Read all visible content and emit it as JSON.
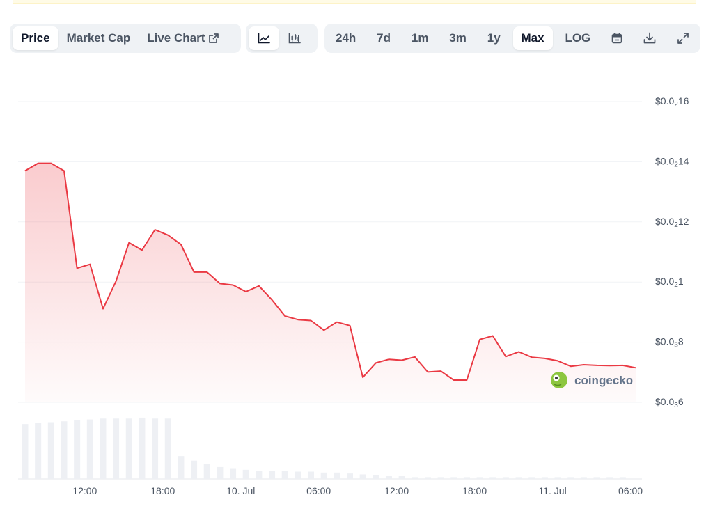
{
  "tabs": [
    {
      "label": "Price",
      "active": true
    },
    {
      "label": "Market Cap",
      "active": false
    },
    {
      "label": "Live Chart",
      "active": false,
      "external": true
    }
  ],
  "chart_types": [
    {
      "icon": "line-chart-icon",
      "active": true
    },
    {
      "icon": "candlestick-chart-icon",
      "active": false
    }
  ],
  "ranges": [
    {
      "label": "24h",
      "active": false
    },
    {
      "label": "7d",
      "active": false
    },
    {
      "label": "1m",
      "active": false
    },
    {
      "label": "3m",
      "active": false
    },
    {
      "label": "1y",
      "active": false
    },
    {
      "label": "Max",
      "active": true
    },
    {
      "label": "LOG",
      "active": false
    }
  ],
  "tool_icons": [
    "calendar-icon",
    "download-icon",
    "expand-icon"
  ],
  "watermark": "coingecko",
  "colors": {
    "line": "#ea3943",
    "volume": "#eef0f4",
    "grid": "#f1f3f6",
    "accent_green": "#8dc63f"
  },
  "chart_data": {
    "type": "area",
    "y_ticks": [
      {
        "prefix": "$0.0",
        "sub": "2",
        "rest": "16",
        "value": 0.0016
      },
      {
        "prefix": "$0.0",
        "sub": "2",
        "rest": "14",
        "value": 0.0014
      },
      {
        "prefix": "$0.0",
        "sub": "2",
        "rest": "12",
        "value": 0.0012
      },
      {
        "prefix": "$0.0",
        "sub": "2",
        "rest": "1",
        "value": 0.001
      },
      {
        "prefix": "$0.0",
        "sub": "3",
        "rest": "8",
        "value": 0.0008
      },
      {
        "prefix": "$0.0",
        "sub": "3",
        "rest": "6",
        "value": 0.0006
      }
    ],
    "ylim": [
      0.0006,
      0.0016
    ],
    "x_ticks": [
      {
        "label": "12:00",
        "hour": 12
      },
      {
        "label": "18:00",
        "hour": 18
      },
      {
        "label": "10. Jul",
        "hour": 24
      },
      {
        "label": "06:00",
        "hour": 30
      },
      {
        "label": "12:00",
        "hour": 36
      },
      {
        "label": "18:00",
        "hour": 42
      },
      {
        "label": "11. Jul",
        "hour": 48
      },
      {
        "label": "06:00",
        "hour": 54
      }
    ],
    "xlim": [
      7.4,
      54.4
    ],
    "price": {
      "hours": [
        7.4,
        8.4,
        9.4,
        10.4,
        11.4,
        12.4,
        13.4,
        14.4,
        15.4,
        16.4,
        17.4,
        18.4,
        19.4,
        20.4,
        21.4,
        22.4,
        23.4,
        24.4,
        25.4,
        26.4,
        27.4,
        28.4,
        29.4,
        30.4,
        31.4,
        32.4,
        33.4,
        34.4,
        35.4,
        36.4,
        37.4,
        38.4,
        39.4,
        40.4,
        41.4,
        42.4,
        43.4,
        44.4,
        45.4,
        46.4,
        47.4,
        48.4,
        49.4,
        50.4,
        51.4,
        52.4,
        53.4,
        54.4
      ],
      "values": [
        0.00137,
        0.001395,
        0.001395,
        0.00137,
        0.001046,
        0.001059,
        0.000911,
        0.001003,
        0.001131,
        0.001106,
        0.001174,
        0.001156,
        0.001125,
        0.001033,
        0.001033,
        0.000995,
        0.00099,
        0.000968,
        0.000987,
        0.000941,
        0.000887,
        0.000875,
        0.000872,
        0.00084,
        0.000867,
        0.000855,
        0.000683,
        0.000731,
        0.000743,
        0.00074,
        0.000751,
        0.000701,
        0.000704,
        0.000674,
        0.000674,
        0.000809,
        0.000821,
        0.000752,
        0.000768,
        0.00075,
        0.000746,
        0.000738,
        0.00072,
        0.000725,
        0.000723,
        0.000722,
        0.000723,
        0.000715
      ]
    },
    "volume": {
      "hours": [
        7.4,
        8.4,
        9.4,
        10.4,
        11.4,
        12.4,
        13.4,
        14.4,
        15.4,
        16.4,
        17.4,
        18.4,
        19.4,
        20.4,
        21.4,
        22.4,
        23.4,
        24.4,
        25.4,
        26.4,
        27.4,
        28.4,
        29.4,
        30.4,
        31.4,
        32.4,
        33.4,
        34.4,
        35.4,
        36.4,
        37.4,
        38.4,
        39.4,
        40.4,
        41.4,
        42.4,
        43.4,
        44.4,
        45.4,
        46.4,
        47.4,
        48.4,
        49.4,
        50.4,
        51.4,
        52.4,
        53.4
      ],
      "values": [
        60,
        61,
        62,
        63,
        64,
        65,
        66,
        66,
        66,
        67,
        66,
        66,
        25,
        20,
        16,
        13,
        11,
        10,
        9,
        9,
        9,
        8,
        8,
        7,
        7,
        6,
        5,
        4,
        3,
        3,
        2,
        2,
        2,
        2,
        2,
        2,
        2,
        2,
        2,
        2,
        2,
        2,
        2,
        2,
        2,
        2,
        2
      ],
      "max": 70
    }
  }
}
